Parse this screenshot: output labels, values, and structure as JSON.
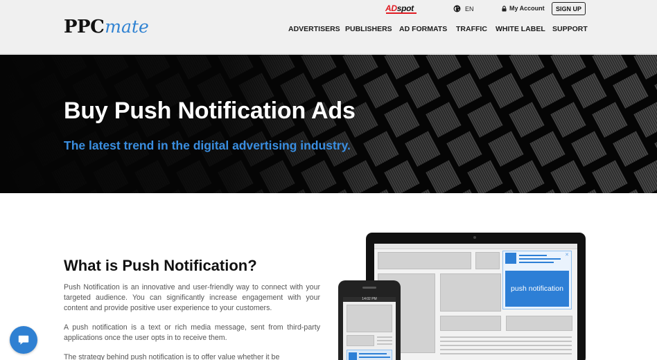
{
  "header": {
    "logo": {
      "primary": "PPC",
      "accent": "mate"
    },
    "partner": {
      "red": "AD",
      "black": "spot"
    },
    "language": "EN",
    "account_label": "My Account",
    "signup_label": "SIGN UP",
    "nav": [
      "ADVERTISERS",
      "PUBLISHERS",
      "AD FORMATS",
      "TRAFFIC",
      "WHITE LABEL",
      "SUPPORT"
    ]
  },
  "hero": {
    "title": "Buy Push Notification Ads",
    "subtitle": "The latest trend in the digital advertising industry."
  },
  "content": {
    "title": "What is Push Notification?",
    "paragraphs": [
      "Push Notification is an innovative and user-friendly way to connect with your targeted audience. You can significantly increase engagement with your content and provide positive user experience to your customers.",
      "A push notification is a text or rich media message, sent from third-party applications once the user opts in to receive them.",
      "The strategy behind push notification is to offer value whether it be"
    ]
  },
  "illustration": {
    "push_label": "push notification",
    "phone_time": "14:02 PM"
  },
  "colors": {
    "accent": "#2f82d2",
    "brand_red": "#e01b22",
    "hero_bg": "#050505",
    "subtitle": "#3a8ee0"
  },
  "icons": {
    "language": "globe-icon",
    "account": "lock-icon",
    "chat": "chat-bubble-icon"
  }
}
